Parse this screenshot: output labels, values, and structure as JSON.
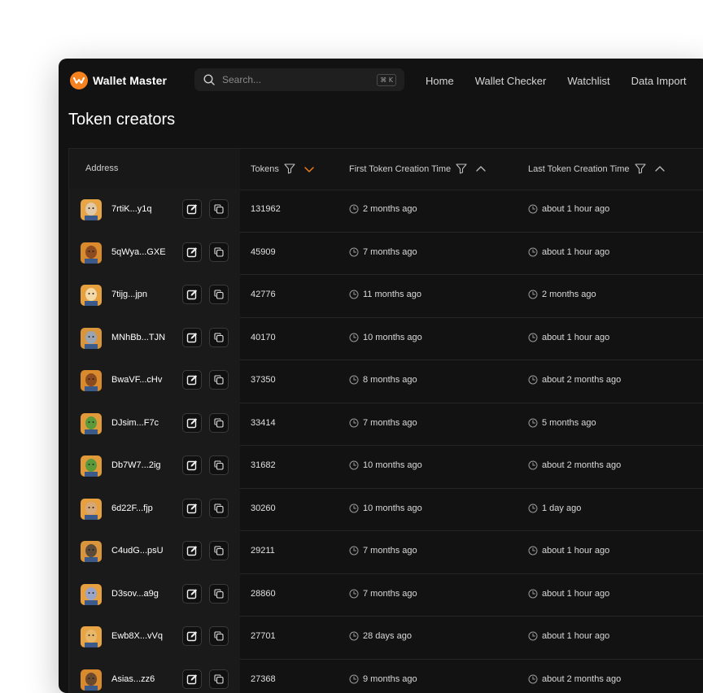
{
  "app": {
    "name": "Wallet Master",
    "brand_color": "#f5821f"
  },
  "search": {
    "placeholder": "Search...",
    "shortcut": "⌘ K"
  },
  "nav": [
    "Home",
    "Wallet Checker",
    "Watchlist",
    "Data Import"
  ],
  "page": {
    "title": "Token creators"
  },
  "table": {
    "headers": {
      "address": "Address",
      "tokens": "Tokens",
      "first": "First Token Creation Time",
      "last": "Last Token Creation Time"
    },
    "sort": {
      "tokens": "descending",
      "accent_color": "#f5821f"
    },
    "rows": [
      {
        "address": "7rtiK...y1q",
        "tokens": "131962",
        "first": "2 months ago",
        "last": "about 1 hour ago",
        "avatar_bg": "#e8a545",
        "avatar_fg": "#e0c8a8"
      },
      {
        "address": "5qWya...GXE",
        "tokens": "45909",
        "first": "7 months ago",
        "last": "about 1 hour ago",
        "avatar_bg": "#d88a2c",
        "avatar_fg": "#8b4a20"
      },
      {
        "address": "7tijg...jpn",
        "tokens": "42776",
        "first": "11 months ago",
        "last": "2 months ago",
        "avatar_bg": "#e6a040",
        "avatar_fg": "#f4d9a8"
      },
      {
        "address": "MNhBb...TJN",
        "tokens": "40170",
        "first": "10 months ago",
        "last": "about 1 hour ago",
        "avatar_bg": "#d9953c",
        "avatar_fg": "#9aa4b2"
      },
      {
        "address": "BwaVF...cHv",
        "tokens": "37350",
        "first": "8 months ago",
        "last": "about 2 months ago",
        "avatar_bg": "#d88a2c",
        "avatar_fg": "#8b4a20"
      },
      {
        "address": "DJsim...F7c",
        "tokens": "33414",
        "first": "7 months ago",
        "last": "5 months ago",
        "avatar_bg": "#e09a3a",
        "avatar_fg": "#5a9a3a"
      },
      {
        "address": "Db7W7...2ig",
        "tokens": "31682",
        "first": "10 months ago",
        "last": "about 2 months ago",
        "avatar_bg": "#e09a3a",
        "avatar_fg": "#5a9a3a"
      },
      {
        "address": "6d22F...fjp",
        "tokens": "30260",
        "first": "10 months ago",
        "last": "1 day ago",
        "avatar_bg": "#e6a040",
        "avatar_fg": "#d4a878"
      },
      {
        "address": "C4udG...psU",
        "tokens": "29211",
        "first": "7 months ago",
        "last": "about 1 hour ago",
        "avatar_bg": "#d9953c",
        "avatar_fg": "#5b4a3a"
      },
      {
        "address": "D3sov...a9g",
        "tokens": "28860",
        "first": "7 months ago",
        "last": "about 1 hour ago",
        "avatar_bg": "#e6a040",
        "avatar_fg": "#9aa4c8"
      },
      {
        "address": "Ewb8X...vVq",
        "tokens": "27701",
        "first": "28 days ago",
        "last": "about 1 hour ago",
        "avatar_bg": "#e8a545",
        "avatar_fg": "#e8b86a"
      },
      {
        "address": "Asias...zz6",
        "tokens": "27368",
        "first": "9 months ago",
        "last": "about 2 months ago",
        "avatar_bg": "#d88a2c",
        "avatar_fg": "#6b4a30"
      }
    ]
  }
}
